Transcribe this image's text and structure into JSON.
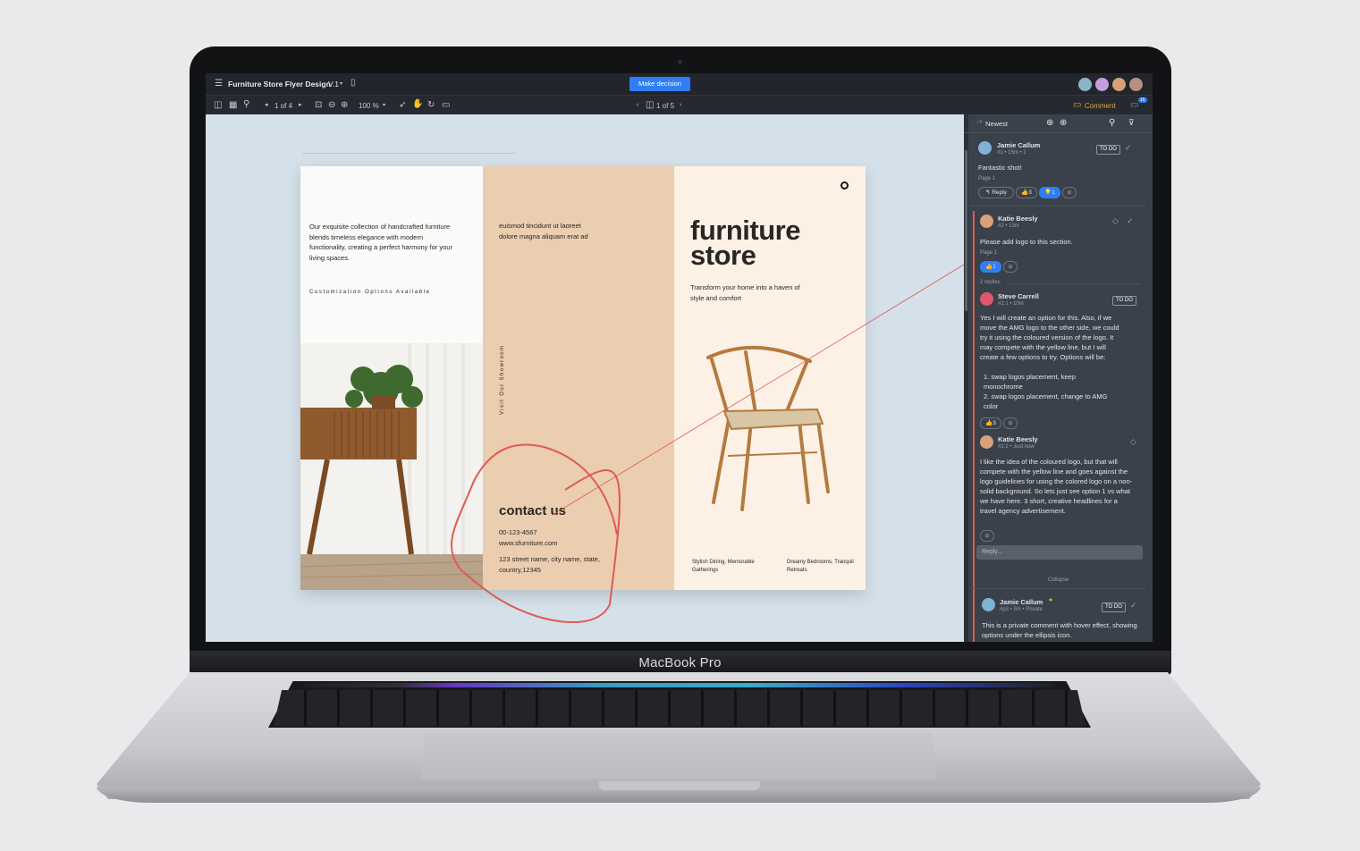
{
  "device": {
    "brand_label": "MacBook Pro"
  },
  "header": {
    "doc_title": "Furniture Store Flyer Design",
    "version": "V.1",
    "decision_button": "Make decision"
  },
  "toolbar": {
    "page_indicator": "1 of 4",
    "zoom": "100 %",
    "frame_indicator": "1 of 5",
    "comment_label": "Comment",
    "comment_count": "16"
  },
  "flyer": {
    "intro": "Our exquisite collection of handcrafted furniture blends timeless elegance with modern functionality, creating a perfect harmony for your living spaces.",
    "customization": "Customization Options Available",
    "lorem": "euismod tincidunt ut laoreet dolore magna aliquam erat ad",
    "showroom": "Visit Our Showroom",
    "contact_title": "contact us",
    "phone": "00-123-4567",
    "website": "www.sfurniture.com",
    "address": "123 street name, city name, state, country,12345",
    "title_line1": "furniture",
    "title_line2": "store",
    "tagline": "Transform your home into a haven of style and comfort",
    "footer_left": "Stylish Dining, Memorable Gatherings",
    "footer_right": "Dreamy Bedrooms, Tranquil Retreats"
  },
  "panel": {
    "sort": "Newest",
    "comments": [
      {
        "author": "Jamie Callum",
        "meta": "#1 • 15m • 1",
        "status": "TO DO",
        "text": "Fantastic shot!",
        "page": "Page 1",
        "reply": "Reply",
        "likes": "3",
        "bulb": "1"
      },
      {
        "author": "Katie Beesly",
        "meta": "#2 • 13m",
        "text": "Please add logo to this section.",
        "page": "Page 1",
        "likes": "1",
        "replies": "2 replies"
      },
      {
        "author": "Steve Carrell",
        "meta": "#2.1 • 10m",
        "status": "TO DO",
        "text": "Yes I will create an option for this.  Also, if we move the AMG logo to the other side, we could try it using the coloured version of the logo.  It may compete with the yellow line, but I will create a few options to try.  Options will be:",
        "items": [
          "swap logos placement, keep monochrome",
          "swap logos placement, change to AMG color"
        ],
        "likes": "3"
      },
      {
        "author": "Katie Beesly",
        "meta": "#2.2 • Just now",
        "text": "I like the idea of the coloured logo, but that will compete with the yellow line and goes against the logo guidelines for using the colored logo on a non-solid background. So lets just see option 1 vs what we have here. 3 short, creative headlines for a travel agency advertisement."
      },
      {
        "author": "Jamie Callum",
        "meta": "#p3 • 5m • Private",
        "status": "TO DO",
        "text": "This is a private comment with hover effect, showing options under the ellipsis icon."
      }
    ],
    "reply_placeholder": "Reply...",
    "collapse": "Collapse"
  },
  "colors": {
    "accent": "#2f7ef5",
    "annotation": "#e05a55",
    "panel_bg": "#3b414a"
  }
}
